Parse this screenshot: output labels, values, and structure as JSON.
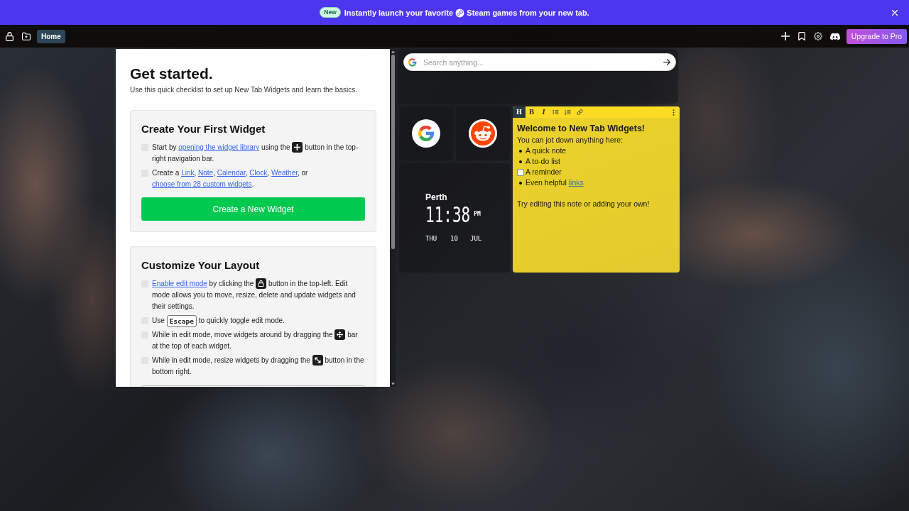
{
  "banner": {
    "badge": "New",
    "message_start": "Instantly launch your favorite",
    "message_end": "Steam games from your new tab."
  },
  "navbar": {
    "tabs": [
      {
        "label": "Home",
        "selected": true
      }
    ],
    "upgrade_button": "Upgrade to Pro"
  },
  "checklist": {
    "title": "Get started.",
    "subtitle": "Use this quick checklist to set up New Tab Widgets and learn the basics.",
    "sections": [
      {
        "heading": "Create Your First Widget",
        "items": [
          {
            "checked": false,
            "parts": [
              {
                "kind": "text",
                "text": "Start by "
              },
              {
                "kind": "link",
                "text": "opening the widget library"
              },
              {
                "kind": "text",
                "text": " using the "
              },
              {
                "kind": "add"
              },
              {
                "kind": "text",
                "text": " button in the top-right navigation bar."
              }
            ]
          },
          {
            "checked": false,
            "parts": [
              {
                "kind": "text",
                "text": "Create a "
              },
              {
                "kind": "link",
                "text": "Link"
              },
              {
                "kind": "text",
                "text": ", "
              },
              {
                "kind": "link",
                "text": "Note"
              },
              {
                "kind": "text",
                "text": ", "
              },
              {
                "kind": "link",
                "text": "Calendar"
              },
              {
                "kind": "text",
                "text": ", "
              },
              {
                "kind": "link",
                "text": "Clock"
              },
              {
                "kind": "text",
                "text": ", "
              },
              {
                "kind": "link",
                "text": "Weather"
              },
              {
                "kind": "text",
                "text": ", or "
              },
              {
                "kind": "link",
                "text": "choose from 28 custom widgets"
              },
              {
                "kind": "text",
                "text": "."
              }
            ]
          }
        ],
        "button": "Create a New Widget"
      },
      {
        "heading": "Customize Your Layout",
        "items": [
          {
            "checked": false,
            "parts": [
              {
                "kind": "link",
                "text": "Enable edit mode"
              },
              {
                "kind": "text",
                "text": " by clicking the "
              },
              {
                "kind": "lock"
              },
              {
                "kind": "text",
                "text": " button in the top-left. Edit mode allows you to move, resize, delete and update widgets and their settings."
              }
            ]
          },
          {
            "checked": false,
            "parts": [
              {
                "kind": "text",
                "text": "Use "
              },
              {
                "kind": "key",
                "text": "Escape"
              },
              {
                "kind": "text",
                "text": " to quickly toggle edit mode."
              }
            ]
          },
          {
            "checked": false,
            "parts": [
              {
                "kind": "text",
                "text": "While in edit mode, move widgets around by dragging the "
              },
              {
                "kind": "move"
              },
              {
                "kind": "text",
                "text": " bar at the top of each widget."
              }
            ]
          },
          {
            "checked": false,
            "parts": [
              {
                "kind": "text",
                "text": "While in edit mode, resize widgets by dragging the "
              },
              {
                "kind": "resize"
              },
              {
                "kind": "text",
                "text": " button in the bottom right."
              }
            ]
          }
        ]
      }
    ]
  },
  "search": {
    "placeholder": "Search anything..."
  },
  "shortcuts": [
    {
      "kind": "google"
    },
    {
      "kind": "reddit"
    }
  ],
  "clock": {
    "city": "Perth",
    "time": "11:38",
    "period": "PM",
    "weekday": "THU",
    "day": "10",
    "month": "JUL"
  },
  "note": {
    "toolbar": [
      {
        "kind": "heading",
        "label": "H",
        "selected": true
      },
      {
        "kind": "bold",
        "label": "B",
        "selected": false
      },
      {
        "kind": "italic",
        "label": "I",
        "selected": false
      },
      {
        "kind": "bullet_list",
        "selected": false
      },
      {
        "kind": "numbered_list",
        "selected": false
      },
      {
        "kind": "link",
        "selected": false
      }
    ],
    "heading": "Welcome to New Tab Widgets!",
    "intro": "You can jot down anything here:",
    "list": [
      {
        "kind": "bullet",
        "text": "A quick note"
      },
      {
        "kind": "bullet",
        "text": "A to-do list"
      },
      {
        "kind": "task",
        "text": "A reminder",
        "checked": false
      },
      {
        "kind": "bullet",
        "text": "Even helpful ",
        "link": "links"
      }
    ],
    "footer": "Try editing this note or adding your own!"
  }
}
